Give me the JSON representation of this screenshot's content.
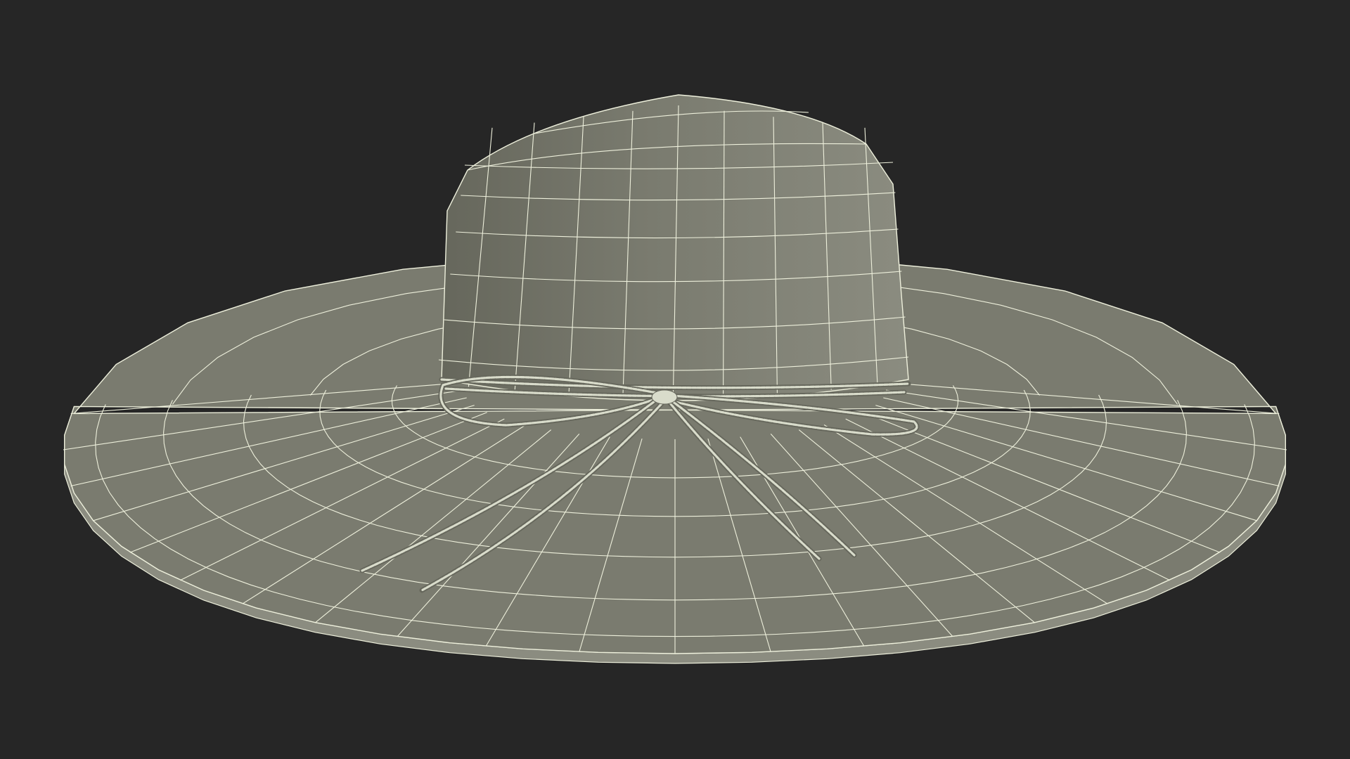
{
  "render": {
    "background_color": "#262626",
    "surface_color": "#7a7b6f",
    "surface_shadow_color": "#66675c",
    "surface_edge_color": "#8b8c80",
    "wire_color": "#eef0dc",
    "cord_color": "#d9dccb"
  },
  "subject": {
    "object": "wide-brim-sun-hat",
    "display_mode": "wireframe-on-shaded"
  }
}
